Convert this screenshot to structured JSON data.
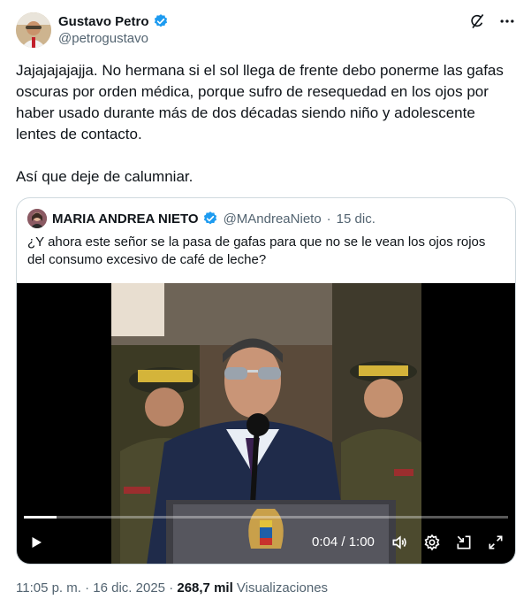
{
  "author": {
    "name": "Gustavo Petro",
    "handle": "@petrogustavo"
  },
  "tweet": {
    "paragraph_1": "Jajajajajajja. No hermana si el sol llega de frente debo ponerme las gafas oscuras por orden médica, porque sufro de resequedad en los ojos por haber usado durante más de dos décadas siendo niño y adolescente lentes de contacto.",
    "paragraph_2": "Así que deje de calumniar."
  },
  "quote": {
    "name": "MARIA ANDREA NIETO",
    "handle": "@MAndreaNieto",
    "separator": "·",
    "date": "15 dic.",
    "text": "¿Y ahora este señor se la pasa de gafas para que no se le vean los ojos rojos del consumo excesivo de café de leche?"
  },
  "video": {
    "time": "0:04 / 1:00",
    "progress_fraction": 0.0667
  },
  "footer": {
    "time": "11:05 p. m.",
    "sep1": "·",
    "date": "16 dic. 2025",
    "sep2": "·",
    "views_count": "268,7 mil",
    "views_label": "Visualizaciones"
  },
  "colors": {
    "verified": "#1d9bf0",
    "text": "#0f1419",
    "secondary": "#536471",
    "border": "#cfd9de"
  },
  "icons": [
    "verified-badge-icon",
    "grok-icon",
    "more-icon",
    "play-icon",
    "volume-icon",
    "settings-icon",
    "picture-in-picture-icon",
    "fullscreen-icon"
  ]
}
